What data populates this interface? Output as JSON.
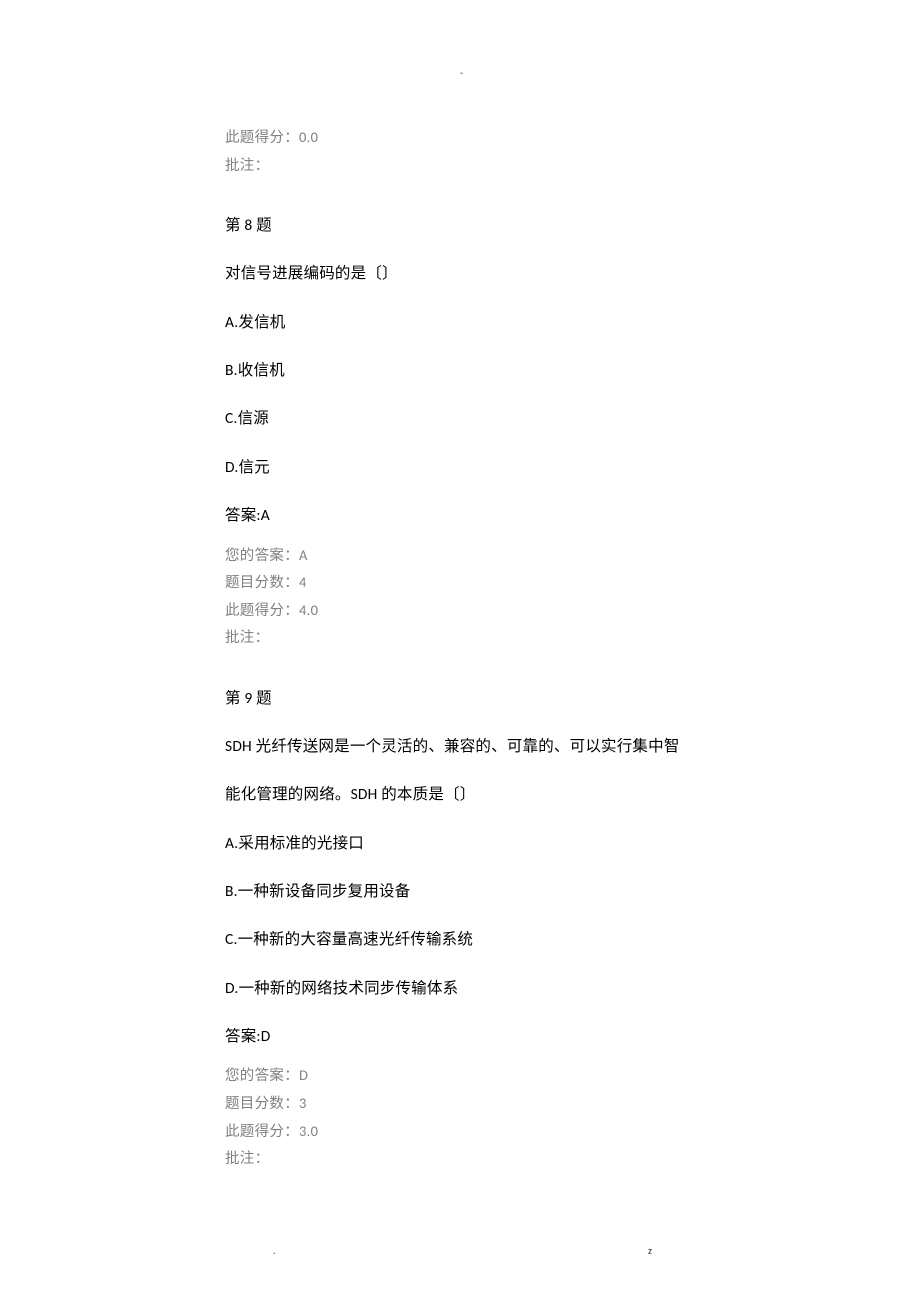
{
  "decorations": {
    "header_dot": "-",
    "footer_left_dot": ".",
    "footer_right": "z"
  },
  "leading_meta": {
    "score_this": "此题得分：0.0",
    "remark": "批注："
  },
  "q8": {
    "header": "第 8 题",
    "question": "对信号进展编码的是〔〕",
    "opt_a": "A.发信机",
    "opt_b": "B.收信机",
    "opt_c": "C.信源",
    "opt_d": "D.信元",
    "answer": "答案:A",
    "your_answer": "您的答案：A",
    "max_score": "题目分数：4",
    "score_this": "此题得分：4.0",
    "remark": "批注："
  },
  "q9": {
    "header": "第 9 题",
    "question_l1": "SDH 光纤传送网是一个灵活的、兼容的、可靠的、可以实行集中智",
    "question_l2": "能化管理的网络。SDH 的本质是〔〕",
    "opt_a": "A.采用标准的光接口",
    "opt_b": "B.一种新设备同步复用设备",
    "opt_c": "C.一种新的大容量高速光纤传输系统",
    "opt_d": "D.一种新的网络技术同步传输体系",
    "answer": "答案:D",
    "your_answer": "您的答案：D",
    "max_score": "题目分数：3",
    "score_this": "此题得分：3.0",
    "remark": "批注："
  }
}
